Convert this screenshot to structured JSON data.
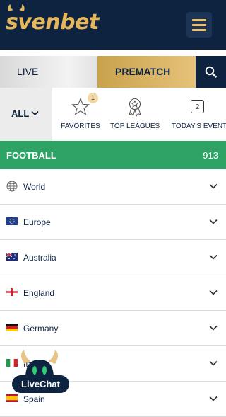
{
  "header": {
    "logo_text": "svenbet"
  },
  "tabs": {
    "live": "LIVE",
    "prematch": "PREMATCH"
  },
  "filters": {
    "all": "ALL",
    "favorites": {
      "label": "FAVORITES",
      "badge": "1"
    },
    "top_leagues": {
      "label": "TOP LEAGUES"
    },
    "todays_events": {
      "label": "TODAY'S EVENTS",
      "count": "2"
    }
  },
  "sport": {
    "name": "FOOTBALL",
    "count": "913"
  },
  "regions": [
    {
      "name": "World",
      "icon": "globe-icon"
    },
    {
      "name": "Europe",
      "icon": "eu-flag"
    },
    {
      "name": "Australia",
      "icon": "australia-flag"
    },
    {
      "name": "England",
      "icon": "england-flag"
    },
    {
      "name": "Germany",
      "icon": "germany-flag"
    },
    {
      "name": "Italy",
      "icon": "italy-flag"
    },
    {
      "name": "Spain",
      "icon": "spain-flag"
    }
  ],
  "livechat": {
    "label": "LiveChat"
  },
  "colors": {
    "navy": "#0d2340",
    "gold": "#e6b65a",
    "green": "#2fa265"
  }
}
